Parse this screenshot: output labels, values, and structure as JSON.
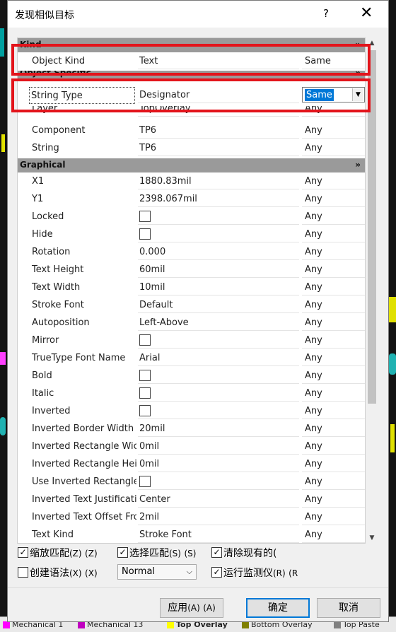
{
  "dialog": {
    "title": "发现相似目标",
    "help_label": "?",
    "close_label": "✕"
  },
  "sections": {
    "kind": "Kind",
    "object_specific": "Object Specific",
    "graphical": "Graphical",
    "collapse_glyph": "»"
  },
  "kind_rows": [
    {
      "name": "Object Kind",
      "value": "Text",
      "mode": "Same"
    }
  ],
  "specific_rows": [
    {
      "name": "String Type",
      "value": "Designator",
      "mode": "Same"
    },
    {
      "name": "Layer",
      "value": "TopOverlay",
      "mode": "Any"
    },
    {
      "name": "Component",
      "value": "TP6",
      "mode": "Any"
    },
    {
      "name": "String",
      "value": "TP6",
      "mode": "Any"
    }
  ],
  "graphical_rows": [
    {
      "name": "X1",
      "value": "1880.83mil",
      "mode": "Any"
    },
    {
      "name": "Y1",
      "value": "2398.067mil",
      "mode": "Any"
    },
    {
      "name": "Locked",
      "value": "",
      "checkbox": true,
      "mode": "Any"
    },
    {
      "name": "Hide",
      "value": "",
      "checkbox": true,
      "mode": "Any"
    },
    {
      "name": "Rotation",
      "value": "0.000",
      "mode": "Any"
    },
    {
      "name": "Text Height",
      "value": "60mil",
      "mode": "Any"
    },
    {
      "name": "Text Width",
      "value": "10mil",
      "mode": "Any"
    },
    {
      "name": "Stroke Font",
      "value": "Default",
      "mode": "Any"
    },
    {
      "name": "Autoposition",
      "value": "Left-Above",
      "mode": "Any"
    },
    {
      "name": "Mirror",
      "value": "",
      "checkbox": true,
      "mode": "Any"
    },
    {
      "name": "TrueType Font Name",
      "value": "Arial",
      "mode": "Any"
    },
    {
      "name": "Bold",
      "value": "",
      "checkbox": true,
      "mode": "Any"
    },
    {
      "name": "Italic",
      "value": "",
      "checkbox": true,
      "mode": "Any"
    },
    {
      "name": "Inverted",
      "value": "",
      "checkbox": true,
      "mode": "Any"
    },
    {
      "name": "Inverted Border Width",
      "value": "20mil",
      "mode": "Any"
    },
    {
      "name": "Inverted Rectangle Wic",
      "value": "0mil",
      "mode": "Any"
    },
    {
      "name": "Inverted Rectangle Hei",
      "value": "0mil",
      "mode": "Any"
    },
    {
      "name": "Use Inverted Rectangle",
      "value": "",
      "checkbox": true,
      "mode": "Any"
    },
    {
      "name": "Inverted Text Justificati",
      "value": "Center",
      "mode": "Any"
    },
    {
      "name": "Inverted Text Offset Fro",
      "value": "2mil",
      "mode": "Any"
    },
    {
      "name": "Text Kind",
      "value": "Stroke Font",
      "mode": "Any"
    }
  ],
  "options": {
    "zoom_matching": {
      "label": "缩放匹配",
      "key": "(Z)",
      "key2": "(Z)",
      "checked": true
    },
    "select_matching": {
      "label": "选择匹配",
      "key": "(S)",
      "key2": "(S)",
      "checked": true
    },
    "clear_existing": {
      "label": "清除现有的(",
      "checked": true
    },
    "create_expression": {
      "label": "创建语法",
      "key": "(X)",
      "key2": "(X)",
      "checked": false
    },
    "mask_mode": {
      "value": "Normal"
    },
    "run_inspector": {
      "label": "运行监测仪",
      "key": "(R)",
      "key2": "(R",
      "checked": true
    }
  },
  "buttons": {
    "apply": {
      "label": "应用",
      "key": "(A)",
      "key2": "(A)"
    },
    "ok": {
      "label": "确定"
    },
    "cancel": {
      "label": "取消"
    }
  },
  "background": {
    "layer_tabs": [
      "Mechanical 1",
      "Mechanical 13",
      "Top Overlay",
      "Bottom Overlay",
      "Top Paste"
    ],
    "layer_colors": [
      "#ff00ff",
      "#c000c0",
      "#ffff00",
      "#808000",
      "#808080"
    ],
    "watermark": "https://blog.csdn.net/geek_monkey"
  },
  "colors": {
    "highlight": "#e3141b",
    "selection": "#0078d7",
    "section_header": "#9a9a9a"
  }
}
